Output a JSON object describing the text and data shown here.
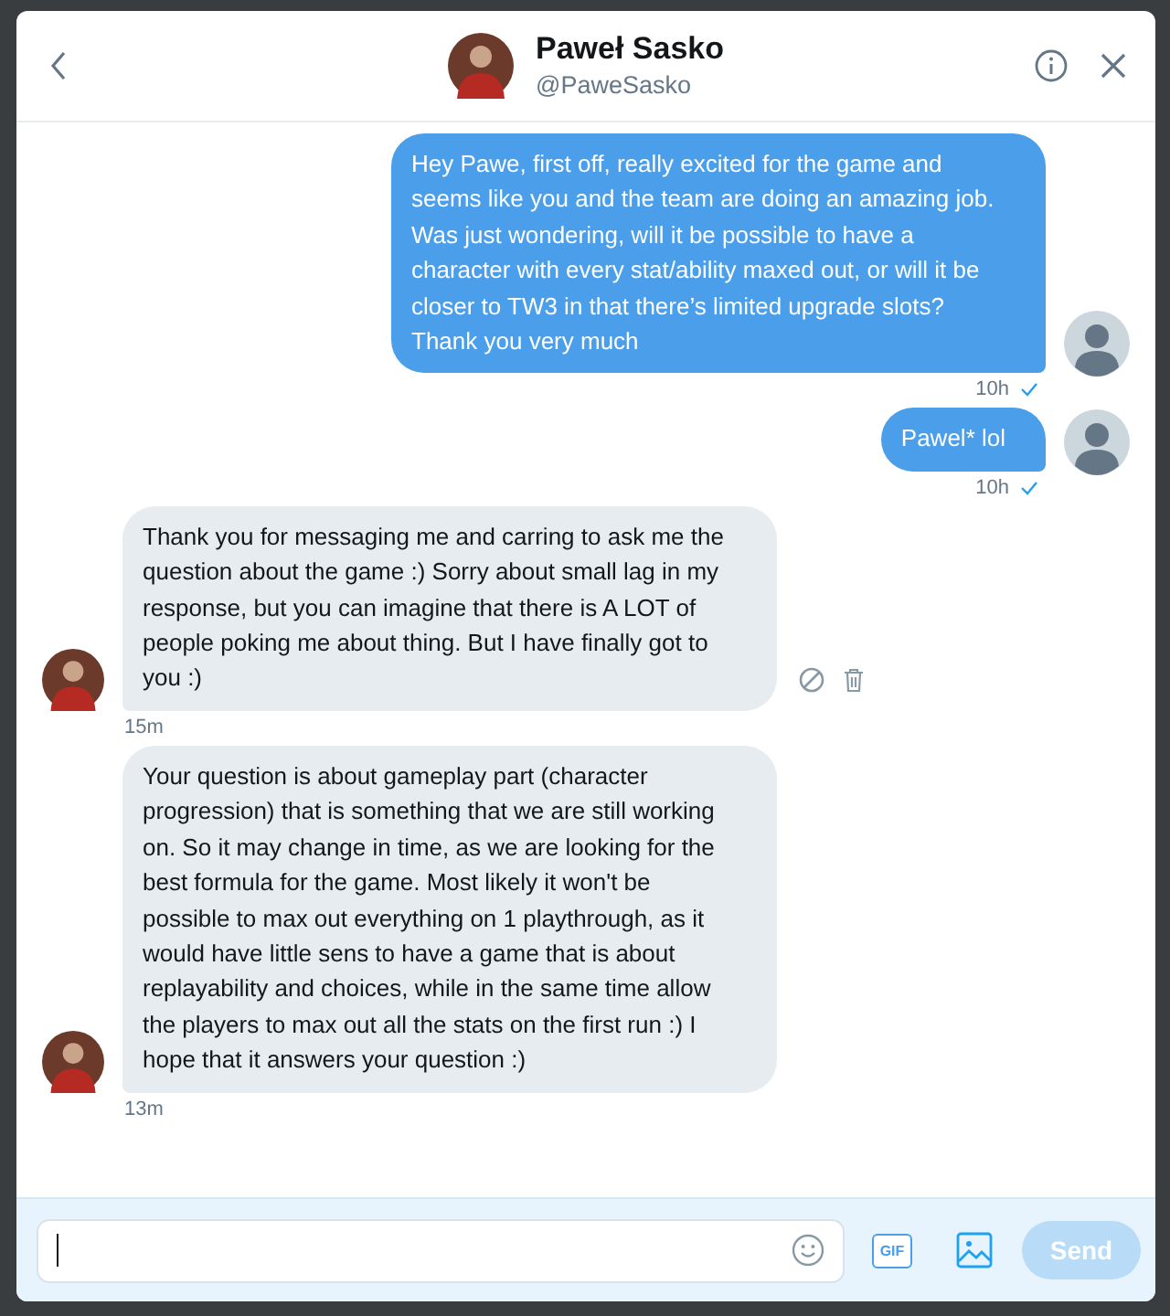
{
  "header": {
    "name": "Paweł Sasko",
    "handle": "@PaweSasko"
  },
  "messages": [
    {
      "kind": "sent",
      "text": "Hey Pawe, first off, really excited for the game and seems like you and the team are doing an amazing job. Was just wondering, will it be possible to have a character with every stat/ability maxed out, or will it be closer to TW3 in that there’s limited upgrade slots? Thank you very much",
      "time": "10h",
      "read": true,
      "actions": false
    },
    {
      "kind": "sent",
      "text": "Pawel* lol",
      "time": "10h",
      "read": true,
      "actions": false
    },
    {
      "kind": "received",
      "text": "Thank you for messaging me and carring to ask me the question about the game :) Sorry about small lag in my response, but you can imagine that there is A LOT of people poking me about thing. But I have finally got to you :)",
      "time": "15m",
      "read": false,
      "actions": true
    },
    {
      "kind": "received",
      "text": "Your question is about gameplay part (character progression) that is something that we are still working on. So it may change in time, as we are looking for the best formula for the game. Most likely it won't be possible to max out everything on 1 playthrough, as it would have little sens to have a game that is about replayability and choices, while in the same time allow the players to max out all the stats on the first run :) I hope that it answers your question :)",
      "time": "13m",
      "read": false,
      "actions": false
    }
  ],
  "composer": {
    "gif_label": "GIF",
    "send": "Send",
    "send_disabled": true
  }
}
